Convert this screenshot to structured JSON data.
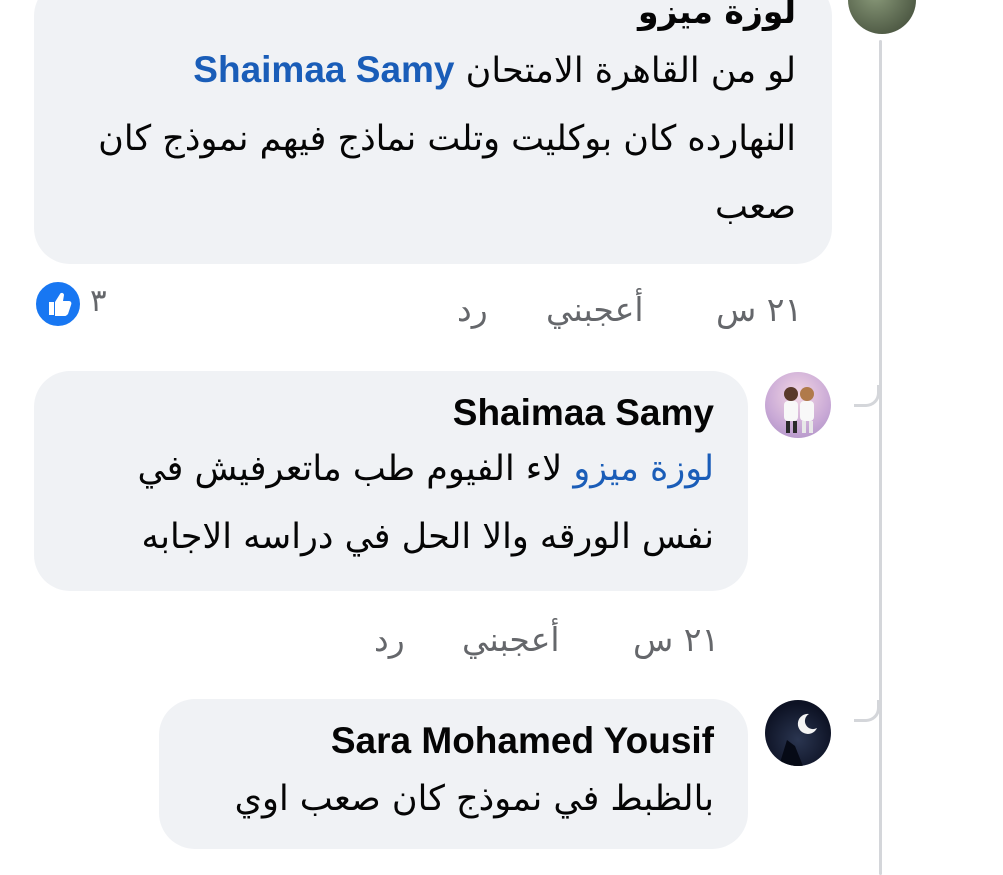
{
  "comments": [
    {
      "author": "لوزة ميزو",
      "mention": "Shaimaa Samy",
      "text_first": "لو من القاهرة الامتحان",
      "text_rest": "النهارده كان بوكليت وتلت نماذج فيهم نموذج كان صعب",
      "time": "٢١ س",
      "like_label": "أعجبني",
      "reply_label": "رد",
      "reaction_count": "٣",
      "reaction_icon": "thumbs-up-icon",
      "reaction_color": "#1877f2"
    },
    {
      "author": "Shaimaa Samy",
      "mention": "لوزة ميزو",
      "text_first": "لاء الفيوم طب ماتعرفيش في",
      "text_rest": "نفس الورقه والا الحل في دراسه الاجابه",
      "time": "٢١ س",
      "like_label": "أعجبني",
      "reply_label": "رد"
    },
    {
      "author": "Sara Mohamed Yousif",
      "text": "بالظبط في نموذج كان صعب اوي"
    }
  ],
  "colors": {
    "bubble": "#f0f2f5",
    "mention": "#1a5db8",
    "meta": "#65676b",
    "thread_line": "#d4d6da"
  }
}
